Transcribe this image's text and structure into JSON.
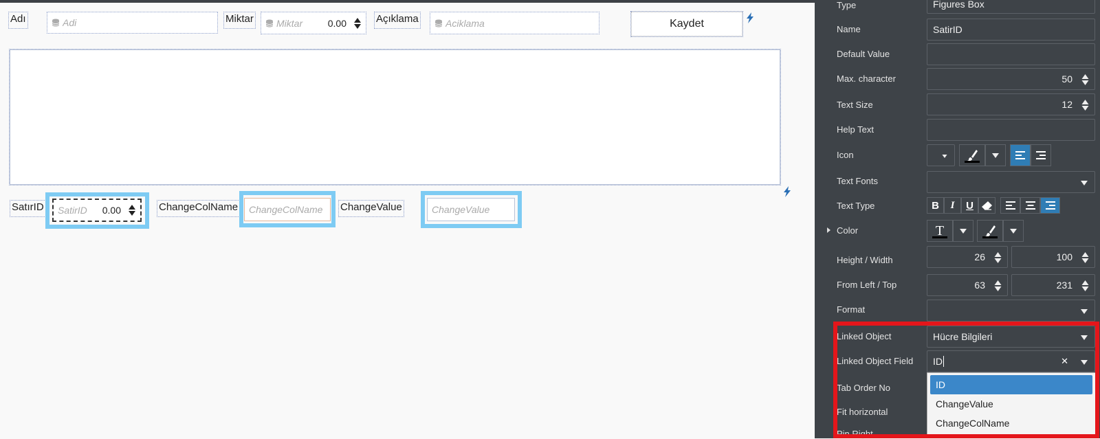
{
  "canvas": {
    "adi": {
      "label": "Adı",
      "placeholder": "Adi"
    },
    "miktar": {
      "label": "Miktar",
      "placeholder": "Miktar",
      "value": "0.00"
    },
    "aciklama": {
      "label": "Açıklama",
      "placeholder": "Aciklama"
    },
    "save_label": "Kaydet",
    "satirid": {
      "label": "SatırID",
      "placeholder": "SatirID",
      "value": "0.00"
    },
    "changecolname": {
      "label": "ChangeColName",
      "placeholder": "ChangeColName"
    },
    "changevalue": {
      "label": "ChangeValue",
      "placeholder": "ChangeValue"
    }
  },
  "properties": {
    "type": {
      "label": "Type",
      "value": "Figures Box"
    },
    "name": {
      "label": "Name",
      "value": "SatirID"
    },
    "default_value": {
      "label": "Default Value",
      "value": ""
    },
    "max_character": {
      "label": "Max. character",
      "value": "50"
    },
    "text_size": {
      "label": "Text Size",
      "value": "12"
    },
    "help_text": {
      "label": "Help Text",
      "value": ""
    },
    "icon": {
      "label": "Icon"
    },
    "text_fonts": {
      "label": "Text Fonts"
    },
    "text_type": {
      "label": "Text Type",
      "bold": "B",
      "italic": "I",
      "underline": "U"
    },
    "color": {
      "label": "Color",
      "text_glyph": "T"
    },
    "height_width": {
      "label": "Height / Width",
      "height": "26",
      "width": "100"
    },
    "from_left_top": {
      "label": "From Left / Top",
      "left": "63",
      "top": "231"
    },
    "format": {
      "label": "Format"
    },
    "linked_object": {
      "label": "Linked Object",
      "value": "Hücre Bilgileri"
    },
    "linked_object_field": {
      "label": "Linked Object Field",
      "value": "ID",
      "clear_glyph": "✕"
    },
    "tab_order_no": {
      "label": "Tab Order No"
    },
    "fit_horizontal": {
      "label": "Fit horizontal"
    },
    "pin_right": {
      "label": "Pin Right"
    },
    "dropdown_options": [
      "ID",
      "ChangeValue",
      "ChangeColName"
    ]
  },
  "colors": {
    "highlight": "#7ecbf3",
    "panel_bg": "#3e4348",
    "accent": "#2f7db5",
    "red_frame": "#e4161b",
    "bolt": "#2a6fb5"
  }
}
